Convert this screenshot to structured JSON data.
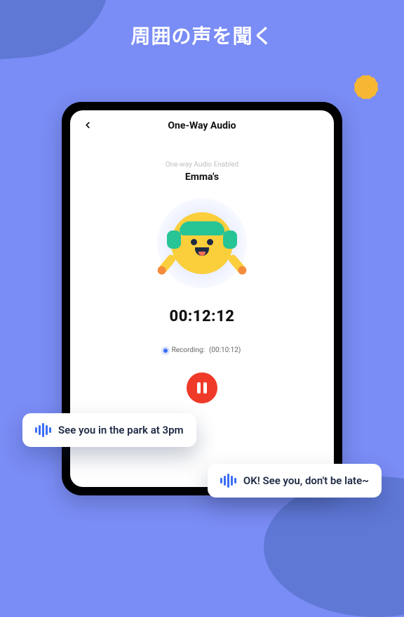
{
  "headline": "周囲の声を聞く",
  "app": {
    "title": "One-Way Audio",
    "status_label": "One-way Audio Enabled",
    "device_name": "Emma's",
    "timer": "00:12:12",
    "recording_label": "Recording:",
    "recording_time": "(00:10:12)"
  },
  "bubbles": {
    "msg1": "See you in the park at 3pm",
    "msg2": "OK! See you, don't be late~"
  },
  "icons": {
    "back": "chevron-left",
    "character": "headphones-emoji",
    "pause": "pause",
    "wave": "audio-wave"
  },
  "colors": {
    "bg": "#7a8cf5",
    "accent": "#3b6df5",
    "danger": "#ef3a29",
    "star": "#f7b733"
  }
}
